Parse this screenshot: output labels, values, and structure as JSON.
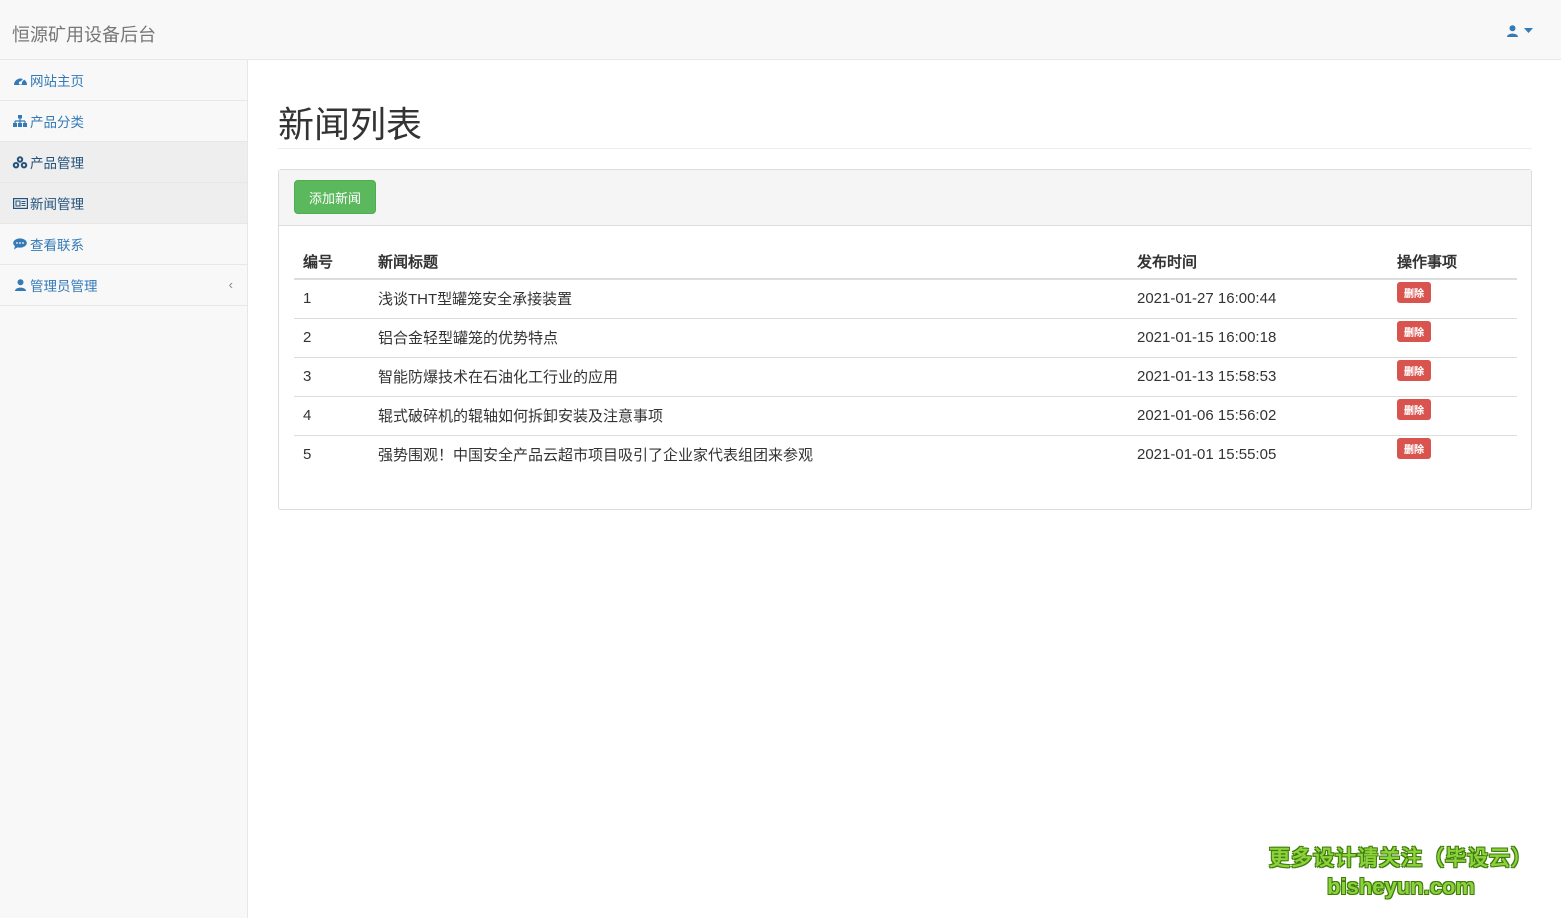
{
  "navbar": {
    "brand": "恒源矿用设备后台",
    "user_icon": "user-icon",
    "caret_icon": "caret-down-icon"
  },
  "sidebar": {
    "items": [
      {
        "label": "网站主页",
        "icon": "dashboard-icon"
      },
      {
        "label": "产品分类",
        "icon": "sitemap-icon"
      },
      {
        "label": "产品管理",
        "icon": "cubes-icon"
      },
      {
        "label": "新闻管理",
        "icon": "newspaper-icon"
      },
      {
        "label": "查看联系",
        "icon": "comments-icon"
      },
      {
        "label": "管理员管理",
        "icon": "user-icon",
        "chevron": "‹"
      }
    ]
  },
  "main": {
    "title": "新闻列表",
    "add_button": "添加新闻",
    "table": {
      "headers": [
        "编号",
        "新闻标题",
        "发布时间",
        "操作事项"
      ],
      "rows": [
        {
          "id": "1",
          "title": "浅谈THT型罐笼安全承接装置",
          "time": "2021-01-27 16:00:44",
          "action": "删除"
        },
        {
          "id": "2",
          "title": "铝合金轻型罐笼的优势特点",
          "time": "2021-01-15 16:00:18",
          "action": "删除"
        },
        {
          "id": "3",
          "title": "智能防爆技术在石油化工行业的应用",
          "time": "2021-01-13 15:58:53",
          "action": "删除"
        },
        {
          "id": "4",
          "title": "辊式破碎机的辊轴如何拆卸安装及注意事项",
          "time": "2021-01-06 15:56:02",
          "action": "删除"
        },
        {
          "id": "5",
          "title": "强势围观！中国安全产品云超市项目吸引了企业家代表组团来参观",
          "time": "2021-01-01 15:55:05",
          "action": "删除"
        }
      ]
    }
  },
  "watermark": {
    "line1": "更多设计请关注（毕设云）",
    "line2": "bisheyun.com"
  },
  "colors": {
    "link": "#337ab7",
    "success": "#5cb85c",
    "danger": "#d9534f"
  }
}
